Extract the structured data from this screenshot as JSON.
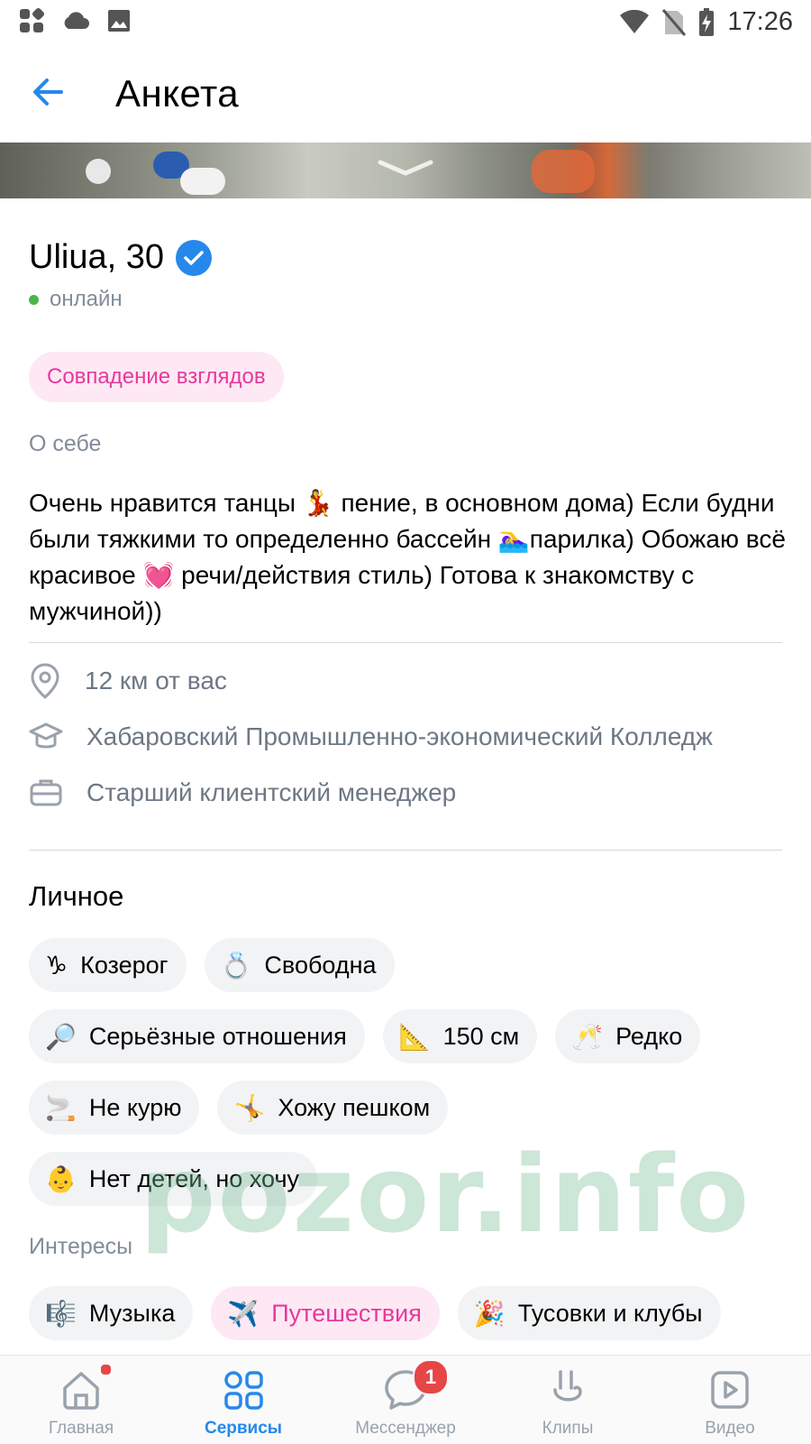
{
  "status_bar": {
    "time": "17:26",
    "left_icons": [
      "apps-icon",
      "cloud-icon",
      "image-icon"
    ],
    "right_icons": [
      "wifi-icon",
      "no-sim-icon",
      "battery-charging-icon"
    ]
  },
  "header": {
    "title": "Анкета",
    "back_icon": "arrow-left-icon"
  },
  "profile": {
    "name_age": "Uliua, 30",
    "verified": true,
    "online_status": "онлайн",
    "match_label": "Совпадение взглядов"
  },
  "about": {
    "label": "О себе",
    "text": "Очень нравится танцы 💃 пение, в основном дома) Если будни были тяжкими то определенно бассейн 🏊‍♀️парилка) Обожаю всё красивое 💓 речи/действия стиль) Готова к знакомству с мужчиной))"
  },
  "info": [
    {
      "icon": "location-pin-icon",
      "text": "12 км от вас"
    },
    {
      "icon": "graduation-cap-icon",
      "text": "Хабаровский Промышленно-экономический Колледж"
    },
    {
      "icon": "briefcase-icon",
      "text": "Старший клиентский менеджер"
    }
  ],
  "personal": {
    "title": "Личное",
    "rows": [
      [
        {
          "emoji": "♑",
          "label": "Козерог"
        },
        {
          "emoji": "💍",
          "label": "Свободна"
        }
      ],
      [
        {
          "emoji": "🔎",
          "label": "Серьёзные отношения"
        },
        {
          "emoji": "📐",
          "label": "150 см"
        },
        {
          "emoji": "🥂",
          "label": "Редко"
        }
      ],
      [
        {
          "emoji": "🚬",
          "label": "Не курю"
        },
        {
          "emoji": "🤸",
          "label": "Хожу пешком"
        }
      ],
      [
        {
          "emoji": "👶",
          "label": "Нет детей, но хочу"
        }
      ]
    ]
  },
  "interests": {
    "label": "Интересы",
    "items": [
      {
        "emoji": "🎼",
        "label": "Музыка",
        "matched": false
      },
      {
        "emoji": "✈️",
        "label": "Путешествия",
        "matched": true
      },
      {
        "emoji": "🎉",
        "label": "Тусовки и клубы",
        "matched": false
      }
    ]
  },
  "watermark": "pozor.info",
  "colors": {
    "accent": "#2688eb",
    "pink": "#e6399b",
    "online": "#4bb34b",
    "badge": "#e64646"
  },
  "tabbar": {
    "tabs": [
      {
        "label": "Главная",
        "icon": "home-icon"
      },
      {
        "label": "Сервисы",
        "icon": "services-icon",
        "active": true
      },
      {
        "label": "Мессенджер",
        "icon": "messenger-icon",
        "badge": "1"
      },
      {
        "label": "Клипы",
        "icon": "clips-icon"
      },
      {
        "label": "Видео",
        "icon": "video-icon"
      }
    ]
  }
}
